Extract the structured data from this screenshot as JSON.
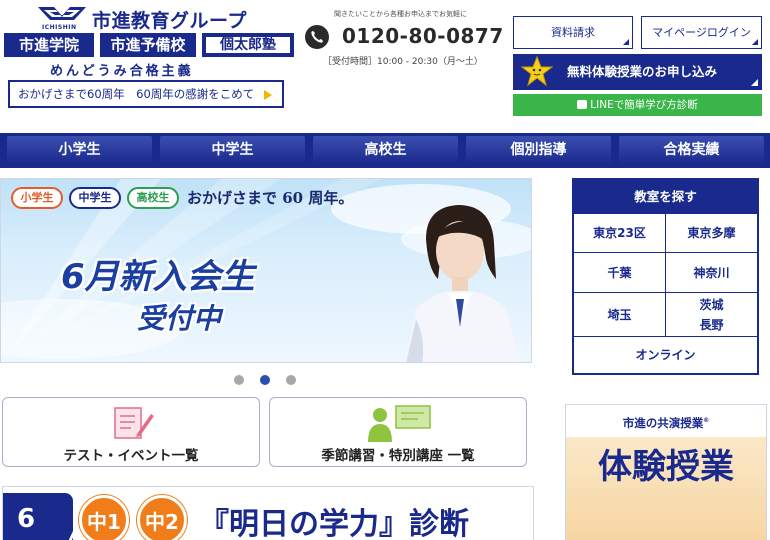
{
  "header": {
    "logo_sub": "ICHISHIN",
    "logo_group": "市進教育グループ",
    "brands": [
      "市進学院",
      "市進予備校",
      "個太郎塾"
    ],
    "tagline": "めんどうみ合格主義",
    "anniversary_text": "おかげさまで60周年　60周年の感謝をこめて",
    "contact_note": "聞きたいことから各種お申込までお気軽に",
    "phone": "0120-80-0877",
    "hours": "［受付時間］10:00 - 20:30（月～土）",
    "doc_request": "資料請求",
    "mypage_login": "マイページログイン",
    "trial_button": "無料体験授業のお申し込み",
    "line_button": "LINEで簡単学び方診断"
  },
  "nav": {
    "items": [
      "小学生",
      "中学生",
      "高校生",
      "個別指導",
      "合格実績"
    ]
  },
  "hero": {
    "pills": [
      "小学生",
      "中学生",
      "高校生"
    ],
    "anniversary": "おかげさまで 60 周年。",
    "headline": "6月新入会生",
    "subheadline": "受付中",
    "carousel_active_index": 1,
    "carousel_count": 3
  },
  "classroom": {
    "title": "教室を探す",
    "areas": [
      "東京23区",
      "東京多摩",
      "千葉",
      "神奈川",
      "埼玉",
      "茨城",
      "長野",
      "オンライン"
    ]
  },
  "quick_links": {
    "test_events": "テスト・イベント一覧",
    "seasonal": "季節講習・特別講座 一覧"
  },
  "banner2": {
    "date_prefix": "6",
    "grades": [
      "中1",
      "中2"
    ],
    "title": "『明日の学力』診断"
  },
  "promo": {
    "top": "市進の共演授業",
    "top_mark": "®",
    "title": "体験授業"
  },
  "colors": {
    "brand_navy": "#1a2a8c",
    "line_green": "#39b54a",
    "accent_orange": "#f07d1a",
    "accent_yellow": "#f2b705"
  }
}
